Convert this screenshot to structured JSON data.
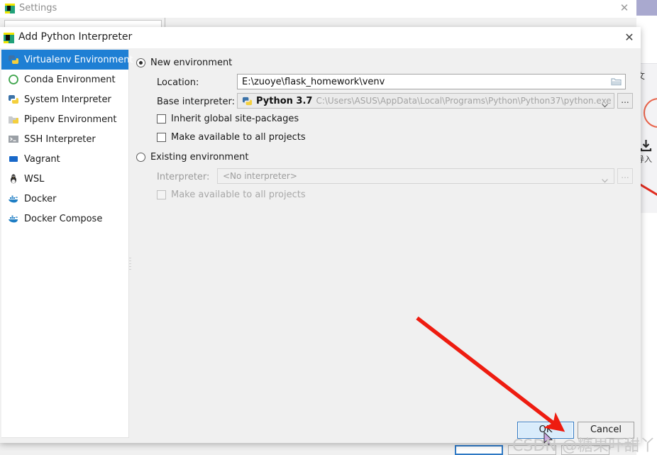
{
  "background_app": {
    "cn_text": "文",
    "download_label": "导入",
    "download_icon": "download-icon",
    "circle_icon": "circle-outline-icon"
  },
  "settings_window": {
    "title": "Settings",
    "icon": "pycharm-icon",
    "close_label": "✕"
  },
  "dialog": {
    "title": "Add Python Interpreter",
    "icon": "pycharm-icon",
    "close_label": "✕"
  },
  "sidebar": {
    "items": [
      {
        "label": "Virtualenv Environment",
        "icon": "virtualenv-icon",
        "selected": true
      },
      {
        "label": "Conda Environment",
        "icon": "conda-icon",
        "selected": false
      },
      {
        "label": "System Interpreter",
        "icon": "python-icon",
        "selected": false
      },
      {
        "label": "Pipenv Environment",
        "icon": "pipenv-icon",
        "selected": false
      },
      {
        "label": "SSH Interpreter",
        "icon": "terminal-icon",
        "selected": false
      },
      {
        "label": "Vagrant",
        "icon": "vagrant-icon",
        "selected": false
      },
      {
        "label": "WSL",
        "icon": "linux-penguin-icon",
        "selected": false
      },
      {
        "label": "Docker",
        "icon": "docker-icon",
        "selected": false
      },
      {
        "label": "Docker Compose",
        "icon": "docker-compose-icon",
        "selected": false
      }
    ]
  },
  "main": {
    "new_environment": {
      "radio_label": "New environment",
      "selected": true,
      "location_label": "Location:",
      "location_value": "E:\\zuoye\\flask_homework\\venv",
      "location_browse_icon": "folder-icon",
      "base_interpreter_label": "Base interpreter:",
      "base_interpreter_name": "Python 3.7",
      "base_interpreter_path": "C:\\Users\\ASUS\\AppData\\Local\\Programs\\Python\\Python37\\python.exe",
      "base_interpreter_icon": "python-icon",
      "base_interpreter_more": "...",
      "inherit_global_label": "Inherit global site-packages",
      "inherit_global_checked": false,
      "make_available_label": "Make available to all projects",
      "make_available_checked": false
    },
    "existing_environment": {
      "radio_label": "Existing environment",
      "selected": false,
      "interpreter_label": "Interpreter:",
      "interpreter_value": "<No interpreter>",
      "interpreter_more": "...",
      "make_available_label": "Make available to all projects",
      "make_available_checked": false
    }
  },
  "footer": {
    "ok_label": "OK",
    "cancel_label": "Cancel",
    "ok_focused": true
  },
  "annotation": {
    "arrow_color": "#ee1c10",
    "arrow_from": "588,448",
    "arrow_to": "788,602"
  },
  "watermark": {
    "text": "CSDN @糖果吓甜丫"
  },
  "colors": {
    "accent_blue": "#1e7fd4",
    "focus_blue": "#2f79c4",
    "dialog_bg": "#f0f0f0",
    "panel_white": "#ffffff",
    "annotation_red": "#ee1c10"
  }
}
